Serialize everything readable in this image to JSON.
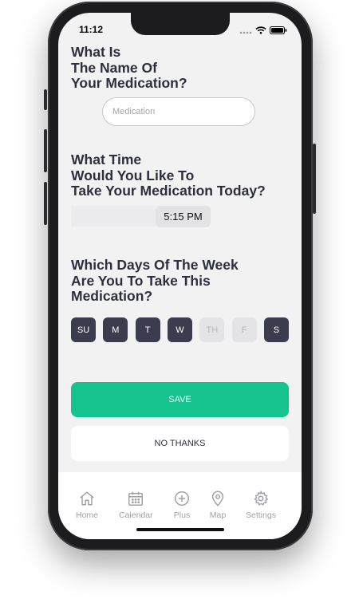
{
  "status_bar": {
    "time": "11:12"
  },
  "questions": {
    "name_lines": [
      "What Is",
      "The Name Of",
      "Your Medication?"
    ],
    "time_lines": [
      "What Time",
      "Would You Like To",
      "Take Your Medication Today?"
    ],
    "days_lines": [
      "Which Days Of The Week",
      "Are You To Take This",
      "Medication?"
    ]
  },
  "medication_input": {
    "placeholder": "Medication",
    "value": ""
  },
  "time_picker": {
    "value": "5:15 PM"
  },
  "days": [
    {
      "label": "SU",
      "selected": true
    },
    {
      "label": "M",
      "selected": true
    },
    {
      "label": "T",
      "selected": true
    },
    {
      "label": "W",
      "selected": true
    },
    {
      "label": "TH",
      "selected": false
    },
    {
      "label": "F",
      "selected": false
    },
    {
      "label": "S",
      "selected": true
    }
  ],
  "buttons": {
    "save": "SAVE",
    "no_thanks": "NO THANKS"
  },
  "tab_bar": [
    {
      "label": "Home",
      "icon": "home-icon"
    },
    {
      "label": "Calendar",
      "icon": "calendar-icon"
    },
    {
      "label": "Plus",
      "icon": "plus-circle-icon"
    },
    {
      "label": "Map",
      "icon": "map-pin-icon"
    },
    {
      "label": "Settings",
      "icon": "gear-icon"
    }
  ],
  "colors": {
    "accent_green": "#14c38e",
    "day_selected": "#3b3c4d",
    "day_unselected": "#e4e4e6",
    "heading_text": "#2e2f3d",
    "tab_inactive": "#a0a0a8"
  }
}
